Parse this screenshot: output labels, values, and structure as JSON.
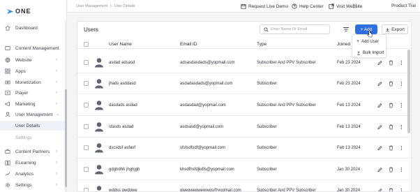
{
  "app": {
    "logo_text": "ONE"
  },
  "breadcrumb": [
    "User Management",
    "User Details"
  ],
  "topbar": {
    "request_demo": "Request Live Demo",
    "help_center": "Help Center",
    "visit_website": "Visit Website",
    "tenant": "Product Trai"
  },
  "sidebar": {
    "items": [
      {
        "label": "Dashboard",
        "icon": "home-icon"
      },
      {
        "label": "Content Management",
        "icon": "folder-icon"
      },
      {
        "label": "Website",
        "icon": "globe-icon"
      },
      {
        "label": "Apps",
        "icon": "apps-icon"
      },
      {
        "label": "Monetization",
        "icon": "money-icon"
      },
      {
        "label": "Player",
        "icon": "play-icon"
      },
      {
        "label": "Marketing",
        "icon": "megaphone-icon"
      },
      {
        "label": "User Management",
        "icon": "user-icon"
      },
      {
        "label": "User Details",
        "sub": true
      },
      {
        "label": "Settings",
        "sub": true
      },
      {
        "label": "Content Partners",
        "icon": "partners-icon"
      },
      {
        "label": "ELearning",
        "icon": "book-icon"
      },
      {
        "label": "Analytics",
        "icon": "chart-icon"
      },
      {
        "label": "Settings",
        "icon": "gear-icon"
      }
    ]
  },
  "users": {
    "title": "Users",
    "search_placeholder": "Enter Name Or Email",
    "add_label": "+ Add",
    "export_label": "Export",
    "menu": {
      "add_user": "Add User",
      "bulk_import": "Bulk Import"
    },
    "columns": {
      "name": "User Name",
      "email": "Email ID",
      "type": "Type",
      "joined": "Joined On"
    },
    "rows": [
      {
        "name": "asdad adsasd",
        "email": "adsasdasdads@yopmail.com",
        "type": "Subscriber And PPV Subscriber",
        "joined": "Feb 23 2024"
      },
      {
        "name": "jhads asddasd",
        "email": "asdadasdads@yopmail.com",
        "type": "Subscriber",
        "joined": "Feb 23 2024"
      },
      {
        "name": "dasdads asdad",
        "email": "asdasdad@yopmail.com",
        "type": "Subscriber And PPV Subscriber",
        "joined": "Feb 13 2024"
      },
      {
        "name": "sfasds asdad",
        "email": "asdsasd@yopmail.com",
        "type": "Subscriber",
        "joined": "Feb 13 2024"
      },
      {
        "name": "dscsdsf asfasf",
        "email": "sfsfsdfsdf@yopmail.com",
        "type": "Subscriber",
        "joined": "Feb 13 2024"
      },
      {
        "name": "gdghdhh jhghjgh",
        "email": "khsdfhsfdjkdfs@yopmail.com",
        "type": "Subscriber",
        "joined": "Jan 30 2024"
      },
      {
        "name": "wddss qwdqwe",
        "email": "qweqweqwewwqs@yopmail.com",
        "type": "Subscriber And PPV Subscriber",
        "joined": "Jan 30 2024"
      }
    ]
  },
  "colors": {
    "accent": "#2f6fe0",
    "sidebar_active": "#eef1f7"
  }
}
